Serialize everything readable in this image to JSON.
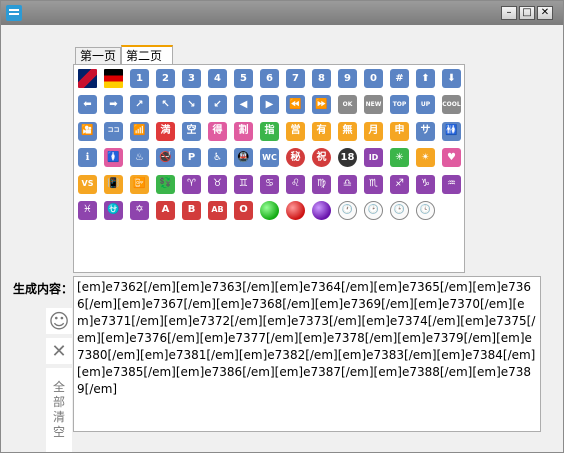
{
  "window": {
    "minimize_label": "–",
    "maximize_label": "□",
    "close_label": "✕"
  },
  "tabs": [
    {
      "label": "第一页"
    },
    {
      "label": "第二页",
      "active": true
    }
  ],
  "emojis": [
    {
      "name": "uk-flag-icon",
      "text": "",
      "bg": "linear-gradient(135deg,#012169 0%,#012169 35%,#c8102e 35%,#c8102e 65%,#012169 65%)",
      "kind": "flag"
    },
    {
      "name": "germany-flag-icon",
      "text": "",
      "bg": "linear-gradient(#000 0%,#000 33%,#dd0000 33%,#dd0000 66%,#ffce00 66%)",
      "kind": "flag"
    },
    {
      "name": "keycap-1-icon",
      "text": "1",
      "bg": "#5b84c4"
    },
    {
      "name": "keycap-2-icon",
      "text": "2",
      "bg": "#5b84c4"
    },
    {
      "name": "keycap-3-icon",
      "text": "3",
      "bg": "#5b84c4"
    },
    {
      "name": "keycap-4-icon",
      "text": "4",
      "bg": "#5b84c4"
    },
    {
      "name": "keycap-5-icon",
      "text": "5",
      "bg": "#5b84c4"
    },
    {
      "name": "keycap-6-icon",
      "text": "6",
      "bg": "#5b84c4"
    },
    {
      "name": "keycap-7-icon",
      "text": "7",
      "bg": "#5b84c4"
    },
    {
      "name": "keycap-8-icon",
      "text": "8",
      "bg": "#5b84c4"
    },
    {
      "name": "keycap-9-icon",
      "text": "9",
      "bg": "#5b84c4"
    },
    {
      "name": "keycap-0-icon",
      "text": "0",
      "bg": "#5b84c4"
    },
    {
      "name": "keycap-hash-icon",
      "text": "#",
      "bg": "#5b84c4"
    },
    {
      "name": "arrow-up-icon",
      "text": "⬆",
      "bg": "#5b84c4"
    },
    {
      "name": "arrow-down-icon",
      "text": "⬇",
      "bg": "#5b84c4"
    },
    {
      "name": "arrow-left-icon",
      "text": "⬅",
      "bg": "#5b84c4"
    },
    {
      "name": "arrow-right-icon",
      "text": "➡",
      "bg": "#5b84c4"
    },
    {
      "name": "arrow-upper-right-icon",
      "text": "↗",
      "bg": "#5b84c4"
    },
    {
      "name": "arrow-upper-left-icon",
      "text": "↖",
      "bg": "#5b84c4"
    },
    {
      "name": "arrow-lower-right-icon",
      "text": "↘",
      "bg": "#5b84c4"
    },
    {
      "name": "arrow-lower-left-icon",
      "text": "↙",
      "bg": "#5b84c4"
    },
    {
      "name": "play-reverse-icon",
      "text": "◀",
      "bg": "#5b84c4"
    },
    {
      "name": "play-icon",
      "text": "▶",
      "bg": "#5b84c4"
    },
    {
      "name": "rewind-icon",
      "text": "⏪",
      "bg": "#5b84c4"
    },
    {
      "name": "fast-forward-icon",
      "text": "⏩",
      "bg": "#5b84c4"
    },
    {
      "name": "ok-icon",
      "text": "OK",
      "bg": "#8a8a8a",
      "kind": "small"
    },
    {
      "name": "new-icon",
      "text": "NEW",
      "bg": "#8a8a8a",
      "kind": "small"
    },
    {
      "name": "top-icon",
      "text": "TOP",
      "bg": "#5b84c4",
      "kind": "small"
    },
    {
      "name": "up-icon",
      "text": "UP",
      "bg": "#5b84c4",
      "kind": "small"
    },
    {
      "name": "cool-icon",
      "text": "COOL",
      "bg": "#8a8a8a",
      "kind": "small"
    },
    {
      "name": "cinema-icon",
      "text": "🎦",
      "bg": "#5b84c4"
    },
    {
      "name": "koko-icon",
      "text": "ココ",
      "bg": "#5b84c4",
      "kind": "small"
    },
    {
      "name": "signal-bars-icon",
      "text": "📶",
      "bg": "#5b84c4"
    },
    {
      "name": "ideograph-full-icon",
      "text": "満",
      "bg": "#e03a3a"
    },
    {
      "name": "ideograph-empty-icon",
      "text": "空",
      "bg": "#5b84c4"
    },
    {
      "name": "ideograph-get-icon",
      "text": "得",
      "bg": "#e05ca0"
    },
    {
      "name": "ideograph-discount-icon",
      "text": "割",
      "bg": "#e05ca0"
    },
    {
      "name": "ideograph-finger-icon",
      "text": "指",
      "bg": "#3bb54a"
    },
    {
      "name": "ideograph-open-icon",
      "text": "営",
      "bg": "#f5a623"
    },
    {
      "name": "ideograph-have-icon",
      "text": "有",
      "bg": "#f5a623"
    },
    {
      "name": "ideograph-none-icon",
      "text": "無",
      "bg": "#f5a623"
    },
    {
      "name": "ideograph-month-icon",
      "text": "月",
      "bg": "#f5a623"
    },
    {
      "name": "ideograph-apply-icon",
      "text": "申",
      "bg": "#f5a623"
    },
    {
      "name": "service-icon",
      "text": "サ",
      "bg": "#5b84c4"
    },
    {
      "name": "restroom-icon",
      "text": "🚻",
      "bg": "#5b84c4"
    },
    {
      "name": "information-icon",
      "text": "ℹ",
      "bg": "#5b84c4"
    },
    {
      "name": "womens-icon",
      "text": "🚺",
      "bg": "#e05ca0"
    },
    {
      "name": "bathing-icon",
      "text": "♨",
      "bg": "#5b84c4"
    },
    {
      "name": "no-smoking-icon",
      "text": "🚭",
      "bg": "#5b84c4"
    },
    {
      "name": "parking-icon",
      "text": "P",
      "bg": "#5b84c4"
    },
    {
      "name": "wheelchair-icon",
      "text": "♿",
      "bg": "#5b84c4"
    },
    {
      "name": "metro-icon",
      "text": "🚇",
      "bg": "#5b84c4"
    },
    {
      "name": "wc-icon",
      "text": "WC",
      "bg": "#5b84c4",
      "kind": "tiny"
    },
    {
      "name": "secret-icon",
      "text": "秘",
      "bg": "#d23c3c",
      "kind": "round"
    },
    {
      "name": "congratulations-icon",
      "text": "祝",
      "bg": "#d23c3c",
      "kind": "round"
    },
    {
      "name": "underage-icon",
      "text": "18",
      "bg": "#333",
      "kind": "round"
    },
    {
      "name": "id-icon",
      "text": "ID",
      "bg": "#8e44ad",
      "kind": "tiny"
    },
    {
      "name": "sparkle-icon",
      "text": "✳",
      "bg": "#3bb54a"
    },
    {
      "name": "eight-pointed-star-icon",
      "text": "✴",
      "bg": "#f5a623"
    },
    {
      "name": "heart-box-icon",
      "text": "♥",
      "bg": "#e05ca0"
    },
    {
      "name": "vs-icon",
      "text": "VS",
      "bg": "#f5a623",
      "kind": "tiny"
    },
    {
      "name": "vibration-icon",
      "text": "📳",
      "bg": "#f5a623"
    },
    {
      "name": "mobile-off-icon",
      "text": "📴",
      "bg": "#f5a623"
    },
    {
      "name": "yen-exchange-icon",
      "text": "💱",
      "bg": "#3bb54a"
    },
    {
      "name": "aries-icon",
      "text": "♈",
      "bg": "#8e44ad"
    },
    {
      "name": "taurus-icon",
      "text": "♉",
      "bg": "#8e44ad"
    },
    {
      "name": "gemini-icon",
      "text": "♊",
      "bg": "#8e44ad"
    },
    {
      "name": "cancer-icon",
      "text": "♋",
      "bg": "#8e44ad"
    },
    {
      "name": "leo-icon",
      "text": "♌",
      "bg": "#8e44ad"
    },
    {
      "name": "virgo-icon",
      "text": "♍",
      "bg": "#8e44ad"
    },
    {
      "name": "libra-icon",
      "text": "♎",
      "bg": "#8e44ad"
    },
    {
      "name": "scorpio-icon",
      "text": "♏",
      "bg": "#8e44ad"
    },
    {
      "name": "sagittarius-icon",
      "text": "♐",
      "bg": "#8e44ad"
    },
    {
      "name": "capricorn-icon",
      "text": "♑",
      "bg": "#8e44ad"
    },
    {
      "name": "aquarius-icon",
      "text": "♒",
      "bg": "#8e44ad"
    },
    {
      "name": "pisces-icon",
      "text": "♓",
      "bg": "#8e44ad"
    },
    {
      "name": "ophiuchus-icon",
      "text": "⛎",
      "bg": "#8e44ad"
    },
    {
      "name": "star-of-david-icon",
      "text": "✡",
      "bg": "#8e44ad"
    },
    {
      "name": "blood-type-a-icon",
      "text": "A",
      "bg": "#d23c3c"
    },
    {
      "name": "blood-type-b-icon",
      "text": "B",
      "bg": "#d23c3c"
    },
    {
      "name": "blood-type-ab-icon",
      "text": "AB",
      "bg": "#d23c3c",
      "kind": "tiny"
    },
    {
      "name": "blood-type-o-icon",
      "text": "O",
      "bg": "#d23c3c"
    },
    {
      "name": "green-circle-icon",
      "text": "",
      "bg": "radial-gradient(circle at 35% 35%, #9f9, #1a1 70%)",
      "kind": "round"
    },
    {
      "name": "red-circle-icon",
      "text": "",
      "bg": "radial-gradient(circle at 35% 35%, #f99, #c11 70%)",
      "kind": "round"
    },
    {
      "name": "purple-circle-icon",
      "text": "",
      "bg": "radial-gradient(circle at 35% 35%, #c9f, #61a 70%)",
      "kind": "round"
    },
    {
      "name": "clock-one-icon",
      "text": "🕐",
      "bg": "#fafafa",
      "kind": "clock"
    },
    {
      "name": "clock-two-icon",
      "text": "🕑",
      "bg": "#fafafa",
      "kind": "clock"
    },
    {
      "name": "clock-three-icon",
      "text": "🕒",
      "bg": "#fafafa",
      "kind": "clock"
    },
    {
      "name": "clock-four-icon",
      "text": "🕓",
      "bg": "#fafafa",
      "kind": "clock"
    }
  ],
  "output": {
    "label": "生成内容：",
    "content": "[em]e7362[/em][em]e7363[/em][em]e7364[/em][em]e7365[/em][em]e7366[/em][em]e7367[/em][em]e7368[/em][em]e7369[/em][em]e7370[/em][em]e7371[/em][em]e7372[/em][em]e7373[/em][em]e7374[/em][em]e7375[/em][em]e7376[/em][em]e7377[/em][em]e7378[/em][em]e7379[/em][em]e7380[/em][em]e7381[/em][em]e7382[/em][em]e7383[/em][em]e7384[/em][em]e7385[/em][em]e7386[/em][em]e7387[/em][em]e7388[/em][em]e7389[/em]"
  },
  "tools": {
    "smile_icon": "☺",
    "clear_icon": "✕",
    "clear_all_chars": [
      "全",
      "部",
      "清",
      "空"
    ]
  }
}
